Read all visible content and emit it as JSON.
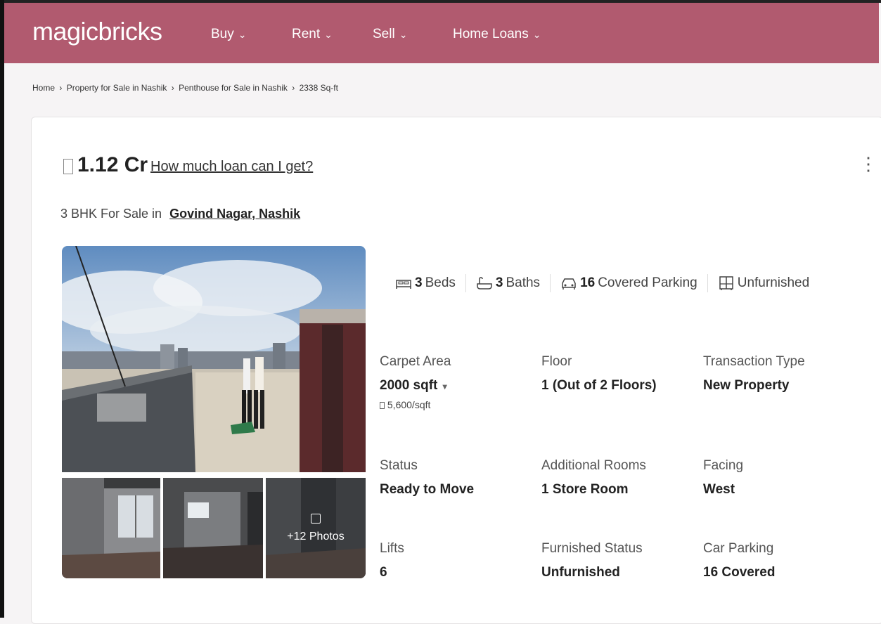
{
  "header": {
    "logo": "magicbricks",
    "nav": [
      {
        "label": "Buy"
      },
      {
        "label": "Rent"
      },
      {
        "label": "Sell"
      },
      {
        "label": "Home Loans"
      }
    ],
    "colors": {
      "brand_bar": "#b15a6f"
    }
  },
  "breadcrumb": {
    "items": [
      "Home",
      "Property for Sale in Nashik",
      "Penthouse for Sale in Nashik",
      "2338 Sq-ft"
    ],
    "separator": "›"
  },
  "listing": {
    "price": "1.12 Cr",
    "loan_link": "How much loan can I get?",
    "subtitle_prefix": "3 BHK For Sale in",
    "location": "Govind Nagar, Nashik",
    "photos_more": "+12 Photos",
    "amenities": [
      {
        "icon": "bed-icon",
        "count": "3",
        "label": "Beds"
      },
      {
        "icon": "bath-icon",
        "count": "3",
        "label": "Baths"
      },
      {
        "icon": "car-icon",
        "count": "16",
        "label": "Covered Parking"
      },
      {
        "icon": "wardrobe-icon",
        "count": "",
        "label": "Unfurnished"
      }
    ],
    "specs": {
      "carpet_area": {
        "label": "Carpet Area",
        "value": "2000 sqft",
        "sub": "5,600/sqft"
      },
      "floor": {
        "label": "Floor",
        "value": "1 (Out of 2 Floors)"
      },
      "transaction_type": {
        "label": "Transaction Type",
        "value": "New Property"
      },
      "status": {
        "label": "Status",
        "value": "Ready to Move"
      },
      "additional_rooms": {
        "label": "Additional Rooms",
        "value": "1 Store Room"
      },
      "facing": {
        "label": "Facing",
        "value": "West"
      },
      "lifts": {
        "label": "Lifts",
        "value": "6"
      },
      "furnished_status": {
        "label": "Furnished Status",
        "value": "Unfurnished"
      },
      "car_parking": {
        "label": "Car Parking",
        "value": "16 Covered"
      }
    }
  }
}
